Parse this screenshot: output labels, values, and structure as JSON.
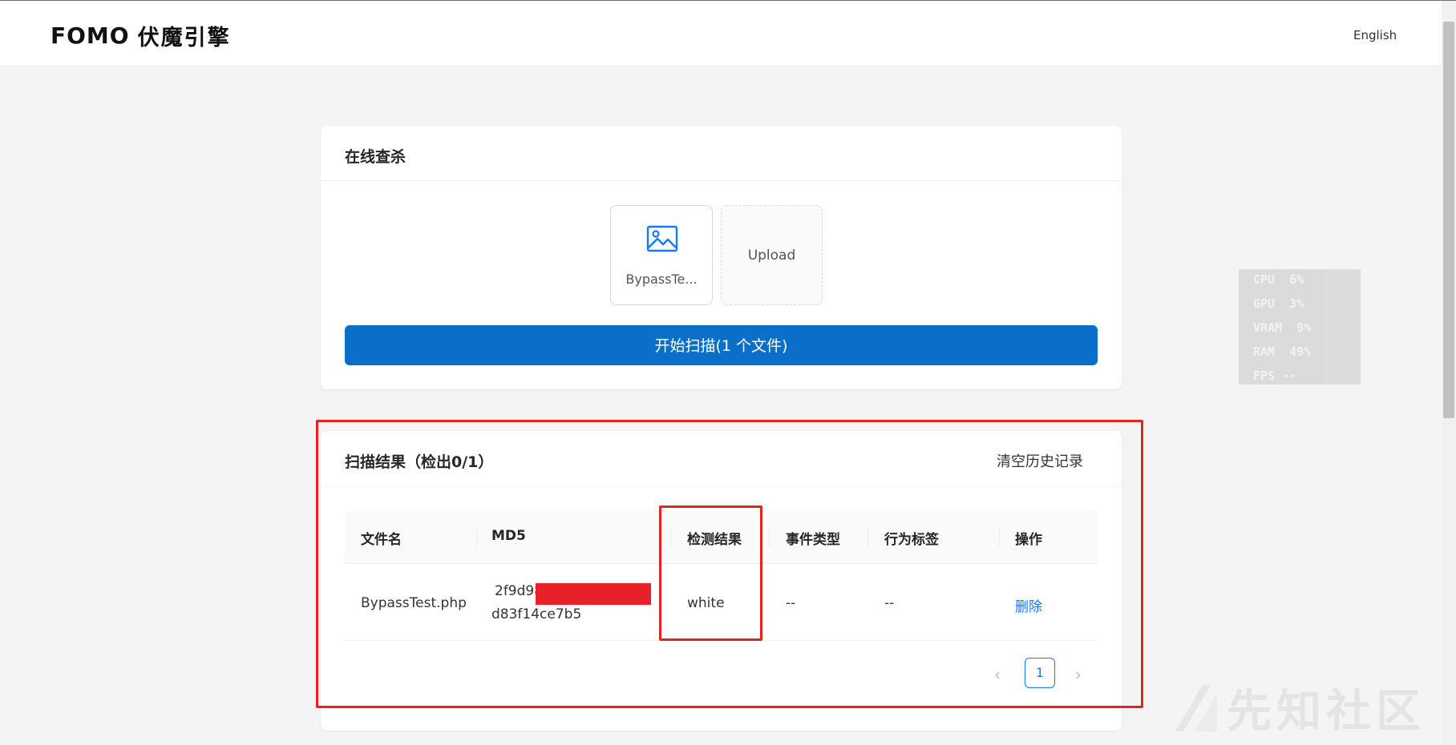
{
  "header": {
    "logo_mark": "FOMO",
    "logo_name": "伏魔引擎",
    "language_label": "English"
  },
  "upload_card": {
    "title": "在线查杀",
    "file": {
      "name": "BypassTe...",
      "icon": "image-icon"
    },
    "upload_label": "Upload",
    "scan_button_label": "开始扫描(1 个文件)"
  },
  "results_card": {
    "title": "扫描结果（检出0/1）",
    "clear_history_label": "清空历史记录",
    "columns": [
      "文件名",
      "MD5",
      "检测结果",
      "事件类型",
      "行为标签",
      "操作"
    ],
    "rows": [
      {
        "filename": "BypassTest.php",
        "md5_line1": "2f9d98",
        "md5_line2": "d83f14ce7b5",
        "result": "white",
        "event_type": "--",
        "behavior_tag": "--",
        "action": "删除"
      }
    ],
    "pagination": {
      "current_page": "1",
      "prev_icon": "chevron-left-icon",
      "next_icon": "chevron-right-icon"
    }
  },
  "overlay_stats": {
    "cpu": "CPU  6%",
    "gpu": "GPU  3%",
    "vram": "VRAM  9%",
    "ram": "RAM  49%",
    "fps": "FPS --"
  },
  "watermark": {
    "text": "先知社区"
  },
  "colors": {
    "primary": "#0a6fc9",
    "link": "#1677ff",
    "annotation": "#e32222",
    "background": "#f4f4f4"
  }
}
